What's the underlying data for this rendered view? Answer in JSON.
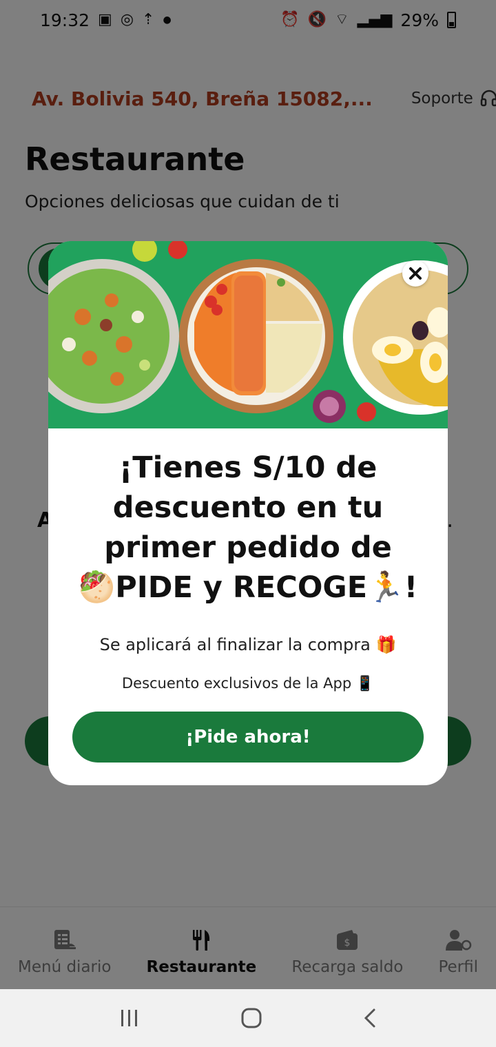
{
  "status_bar": {
    "time": "19:32",
    "battery": "29%"
  },
  "header": {
    "address": "Av. Bolivia 540, Breña 15082,...",
    "support_label": "Soporte"
  },
  "page": {
    "title": "Restaurante",
    "subtitle": "Opciones deliciosas que cuidan de ti"
  },
  "background_partial": {
    "left_letter": "A",
    "right_letter": "a."
  },
  "modal": {
    "headline_line1": "¡Tienes S/10 de",
    "headline_line2": "descuento en tu",
    "headline_line3": "primer pedido de",
    "headline_line4_emoji_left": "🥙",
    "headline_line4_text": "PIDE y RECOGE",
    "headline_line4_emoji_right": "🏃",
    "headline_line4_end": "!",
    "info_text": "Se aplicará al finalizar la compra",
    "info_emoji": "🎁",
    "exclusive_text": "Descuento exclusivos de la App",
    "exclusive_emoji": "📱",
    "cta_label": "¡Pide ahora!"
  },
  "bottom_nav": {
    "items": [
      {
        "label": "Menú diario",
        "icon": "menu-list-icon",
        "active": false
      },
      {
        "label": "Restaurante",
        "icon": "fork-knife-icon",
        "active": true
      },
      {
        "label": "Recarga saldo",
        "icon": "wallet-icon",
        "active": false
      },
      {
        "label": "Perfil",
        "icon": "profile-icon",
        "active": false
      }
    ]
  },
  "colors": {
    "brand_green": "#1a7a3c",
    "hero_green": "#21a25d",
    "address_red": "#b33c1e"
  }
}
